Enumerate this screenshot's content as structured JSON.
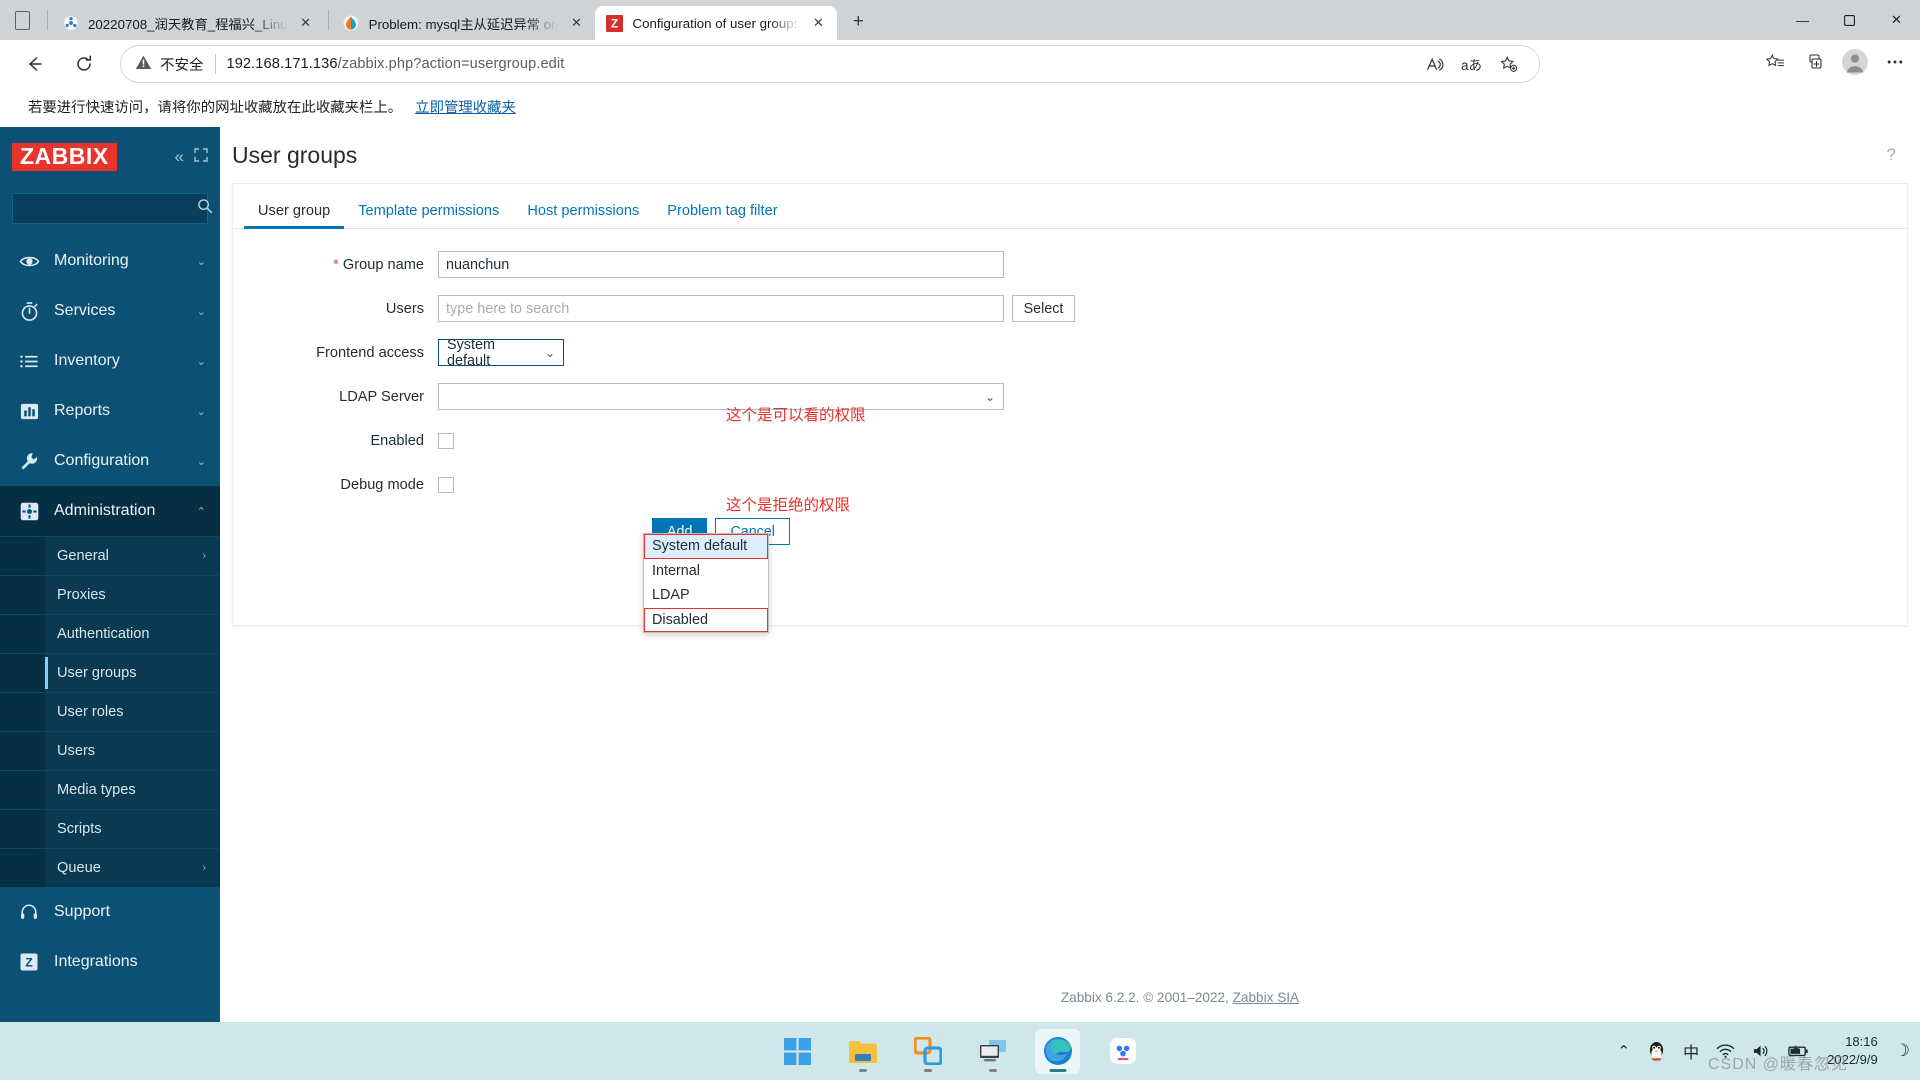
{
  "browser": {
    "tabs": [
      {
        "title": "20220708_润天教育_程福兴_Linu",
        "favicon": "generic-blue-icon",
        "active": false
      },
      {
        "title": "Problem: mysql主从延迟异常 on",
        "favicon": "zabbix-problem-icon",
        "active": false
      },
      {
        "title": "Configuration of user groups",
        "favicon": "zabbix-icon",
        "active": true
      }
    ],
    "new_tab_label": "+",
    "close_label": "✕",
    "window_controls": {
      "minimize": "—",
      "maximize": "▢",
      "close": "✕"
    },
    "omnibox": {
      "security_text": "不安全",
      "url_host": "192.168.171.136",
      "url_path": "/zabbix.php?action=usergroup.edit"
    },
    "bookmark_bar": {
      "text": "若要进行快速访问，请将你的网址收藏放在此收藏夹栏上。",
      "link": "立即管理收藏夹"
    }
  },
  "sidebar": {
    "logo": "ZABBIX",
    "collapse_label": "«",
    "hide_label": "⛶",
    "search_placeholder": "",
    "items": [
      {
        "label": "Monitoring",
        "icon": "eye-icon",
        "chevron": "⌄"
      },
      {
        "label": "Services",
        "icon": "stopwatch-icon",
        "chevron": "⌄"
      },
      {
        "label": "Inventory",
        "icon": "list-icon",
        "chevron": "⌄"
      },
      {
        "label": "Reports",
        "icon": "bar-chart-icon",
        "chevron": "⌄"
      },
      {
        "label": "Configuration",
        "icon": "wrench-icon",
        "chevron": "⌄"
      },
      {
        "label": "Administration",
        "icon": "gear-icon",
        "chevron": "⌃"
      }
    ],
    "admin_submenu": [
      {
        "label": "General",
        "chevron": "›",
        "selected": false
      },
      {
        "label": "Proxies",
        "chevron": "",
        "selected": false
      },
      {
        "label": "Authentication",
        "chevron": "",
        "selected": false
      },
      {
        "label": "User groups",
        "chevron": "",
        "selected": true
      },
      {
        "label": "User roles",
        "chevron": "",
        "selected": false
      },
      {
        "label": "Users",
        "chevron": "",
        "selected": false
      },
      {
        "label": "Media types",
        "chevron": "",
        "selected": false
      },
      {
        "label": "Scripts",
        "chevron": "",
        "selected": false
      },
      {
        "label": "Queue",
        "chevron": "›",
        "selected": false
      }
    ],
    "bottom_items": [
      {
        "label": "Support",
        "icon": "headset-icon"
      },
      {
        "label": "Integrations",
        "icon": "zabbix-z-icon"
      }
    ]
  },
  "header": {
    "title": "User groups",
    "help_icon": "?"
  },
  "tabs": [
    {
      "label": "User group",
      "selected": true
    },
    {
      "label": "Template permissions",
      "selected": false
    },
    {
      "label": "Host permissions",
      "selected": false
    },
    {
      "label": "Problem tag filter",
      "selected": false
    }
  ],
  "form": {
    "group_name": {
      "required_marker": "*",
      "label": "Group name",
      "value": "nuanchun"
    },
    "users": {
      "label": "Users",
      "value": "",
      "placeholder": "type here to search",
      "select_button": "Select"
    },
    "frontend_access": {
      "label": "Frontend access",
      "value": "System default",
      "caret": "⌄"
    },
    "ldap_server": {
      "label": "LDAP Server",
      "value": "",
      "caret": "⌄"
    },
    "enabled": {
      "label": "Enabled"
    },
    "debug_mode": {
      "label": "Debug mode"
    },
    "dropdown_options": [
      {
        "label": "System default",
        "highlighted": true,
        "annotated": true
      },
      {
        "label": "Internal",
        "highlighted": false,
        "annotated": false
      },
      {
        "label": "LDAP",
        "highlighted": false,
        "annotated": false
      },
      {
        "label": "Disabled",
        "highlighted": false,
        "annotated": true
      }
    ],
    "buttons": {
      "add": "Add",
      "cancel": "Cancel"
    }
  },
  "annotations": [
    {
      "text": "这个是可以看的权限",
      "color": "#e8312a"
    },
    {
      "text": "这个是拒绝的权限",
      "color": "#e8312a"
    }
  ],
  "footer": {
    "text": "Zabbix 6.2.2. © 2001–2022, ",
    "link": "Zabbix SIA"
  },
  "taskbar": {
    "icons": [
      {
        "name": "start-windows-icon",
        "running": false,
        "active": false
      },
      {
        "name": "file-explorer-icon",
        "running": true,
        "active": false
      },
      {
        "name": "vmware-workstation-icon",
        "running": true,
        "active": false
      },
      {
        "name": "remote-desktop-icon",
        "running": true,
        "active": false
      },
      {
        "name": "microsoft-edge-icon",
        "running": true,
        "active": true
      },
      {
        "name": "baidu-netdisk-icon",
        "running": false,
        "active": false
      }
    ],
    "tray": {
      "chevron": "⌃",
      "qq_icon": "qq-penguin-icon",
      "ime": "中",
      "wifi_icon": "wifi-icon",
      "volume_icon": "speaker-icon",
      "battery_icon": "battery-charging-icon",
      "time": "18:16",
      "date": "2022/9/9",
      "notification_icon": "☽"
    },
    "watermark": "CSDN @暖春忽见"
  },
  "colors": {
    "zabbix_red": "#e8342b",
    "sidebar_blue": "#0c5174",
    "accent_blue": "#0275b8",
    "annotation_red": "#e8312a"
  }
}
